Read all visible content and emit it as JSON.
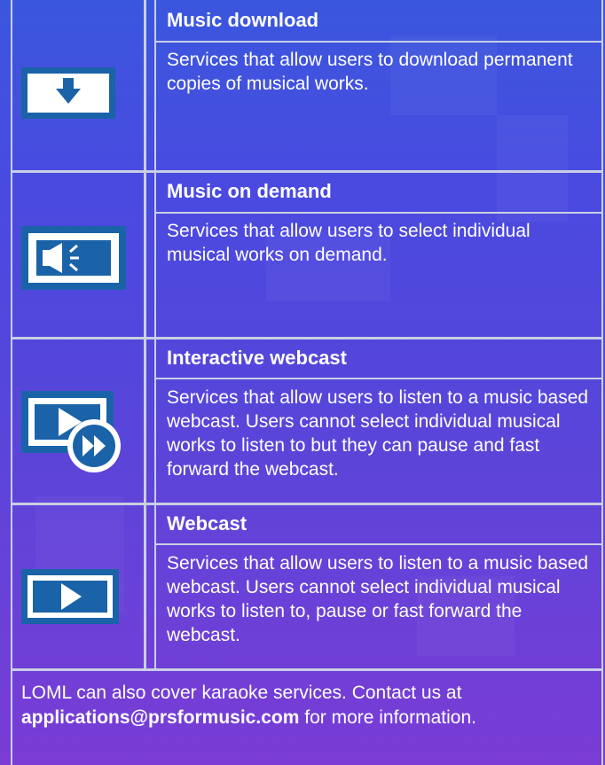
{
  "rows": [
    {
      "title": "Music download",
      "description": "Services that allow users to download permanent copies of musical works.",
      "icon": "download-arrow-icon"
    },
    {
      "title": "Music on demand",
      "description": "Services that allow users to select individual musical works on demand.",
      "icon": "speaker-icon"
    },
    {
      "title": "Interactive webcast",
      "description": "Services that allow users to listen to a music based webcast. Users cannot select individual musical works to listen to but they can pause and fast forward the webcast.",
      "icon": "play-fast-forward-icon"
    },
    {
      "title": "Webcast",
      "description": "Services that allow users to listen to a music based webcast. Users cannot select individual musical works to listen to, pause or fast forward the webcast.",
      "icon": "play-icon"
    }
  ],
  "footer": {
    "text_before": "LOML can also cover karaoke services.  Contact us at",
    "email": "applications@prsformusic.com",
    "text_after": "for more information."
  },
  "colors": {
    "icon_blue": "#1a63a8",
    "border": "#c9cfe3",
    "text": "#ffffff"
  }
}
